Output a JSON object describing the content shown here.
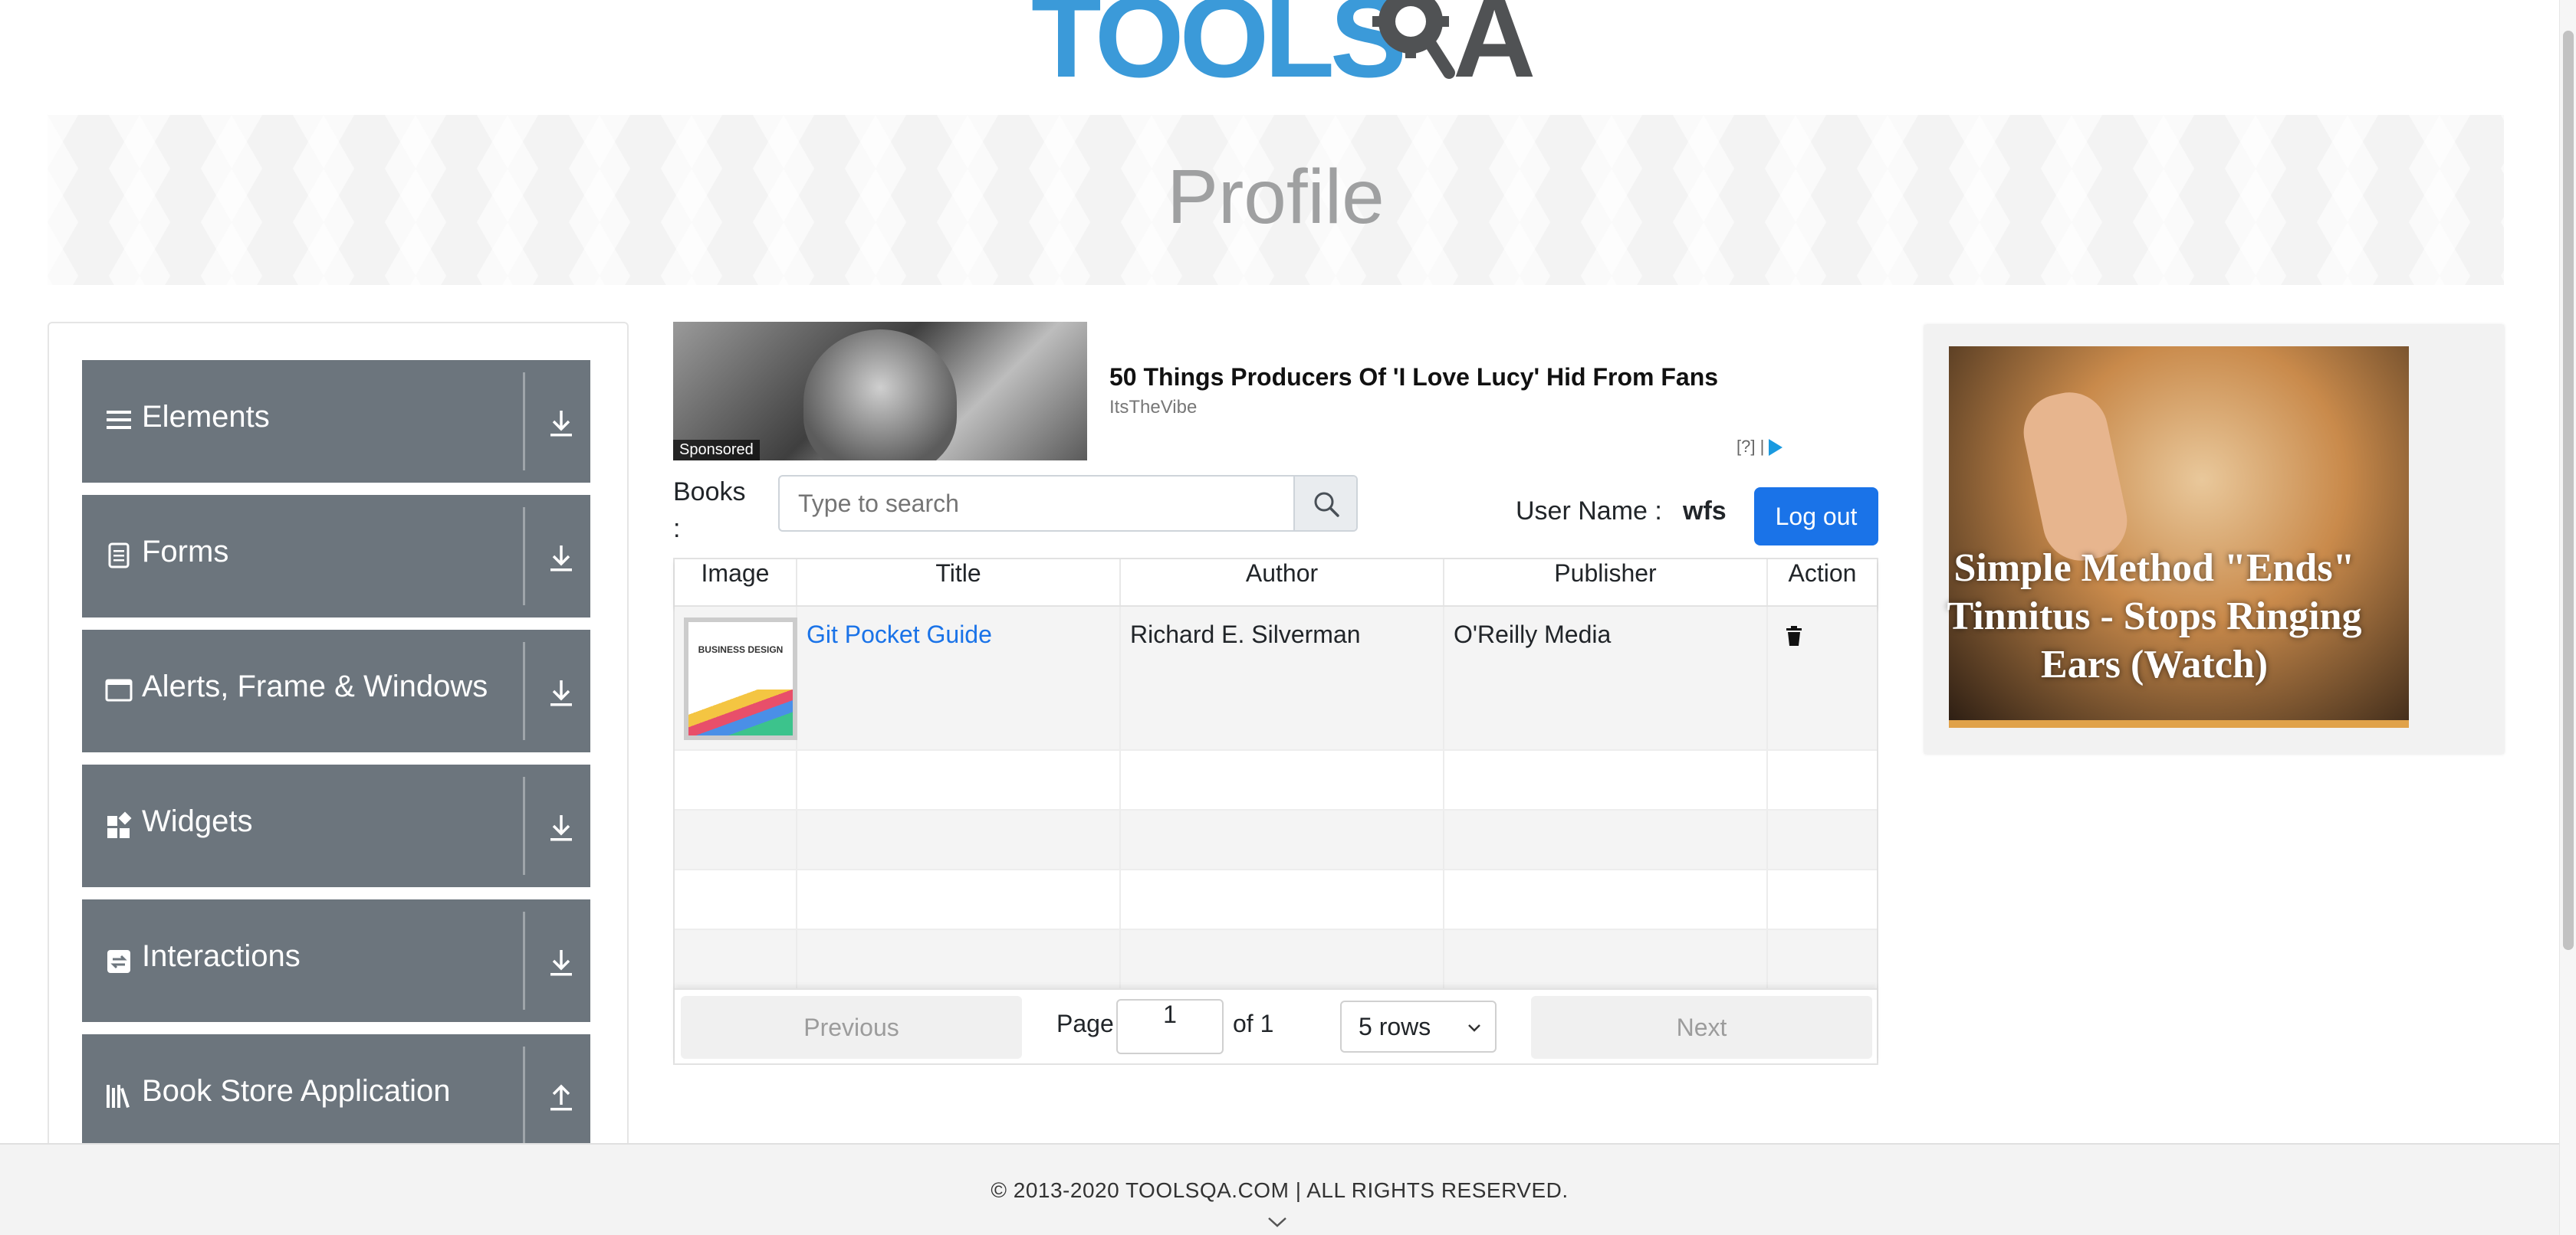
{
  "brand": {
    "logo_text": "TOOLSQA"
  },
  "banner": {
    "title": "Profile"
  },
  "nav": {
    "groups": [
      {
        "label": "Elements",
        "icon": "menu-icon",
        "arrow": "download-icon"
      },
      {
        "label": "Forms",
        "icon": "document-icon",
        "arrow": "download-icon"
      },
      {
        "label": "Alerts, Frame & Windows",
        "icon": "window-icon",
        "arrow": "download-icon"
      },
      {
        "label": "Widgets",
        "icon": "widgets-icon",
        "arrow": "download-icon"
      },
      {
        "label": "Interactions",
        "icon": "interactions-icon",
        "arrow": "download-icon"
      },
      {
        "label": "Book Store Application",
        "icon": "books-icon",
        "arrow": "upload-icon"
      }
    ]
  },
  "ad_top": {
    "badge": "Sponsored",
    "headline": "50 Things Producers Of 'I Love Lucy' Hid From Fans",
    "source": "ItsTheVibe",
    "choice": "[?]"
  },
  "books": {
    "label": "Books :",
    "search_placeholder": "Type to search",
    "user_label": "User Name :",
    "user_value": "wfs",
    "logout_label": "Log out"
  },
  "table": {
    "columns": [
      "Image",
      "Title",
      "Author",
      "Publisher",
      "Action"
    ],
    "rows": [
      {
        "cover_text": "BUSINESS DESIGN",
        "title": "Git Pocket Guide",
        "author": "Richard E. Silverman",
        "publisher": "O'Reilly Media",
        "action_icon": "trash-icon"
      }
    ]
  },
  "pagination": {
    "previous": "Previous",
    "page_label": "Page",
    "page_value": "1",
    "of_label": "of 1",
    "rows_option": "5 rows",
    "next": "Next"
  },
  "ad_right": {
    "headline": "Simple Method \"Ends\" Tinnitus - Stops Ringing Ears (Watch)"
  },
  "footer": {
    "copyright": "© 2013-2020 TOOLSQA.COM | ALL RIGHTS RESERVED."
  },
  "colors": {
    "nav_bg": "#6c757d",
    "primary": "#1a73e8",
    "logo_blue": "#3b9ad9"
  }
}
